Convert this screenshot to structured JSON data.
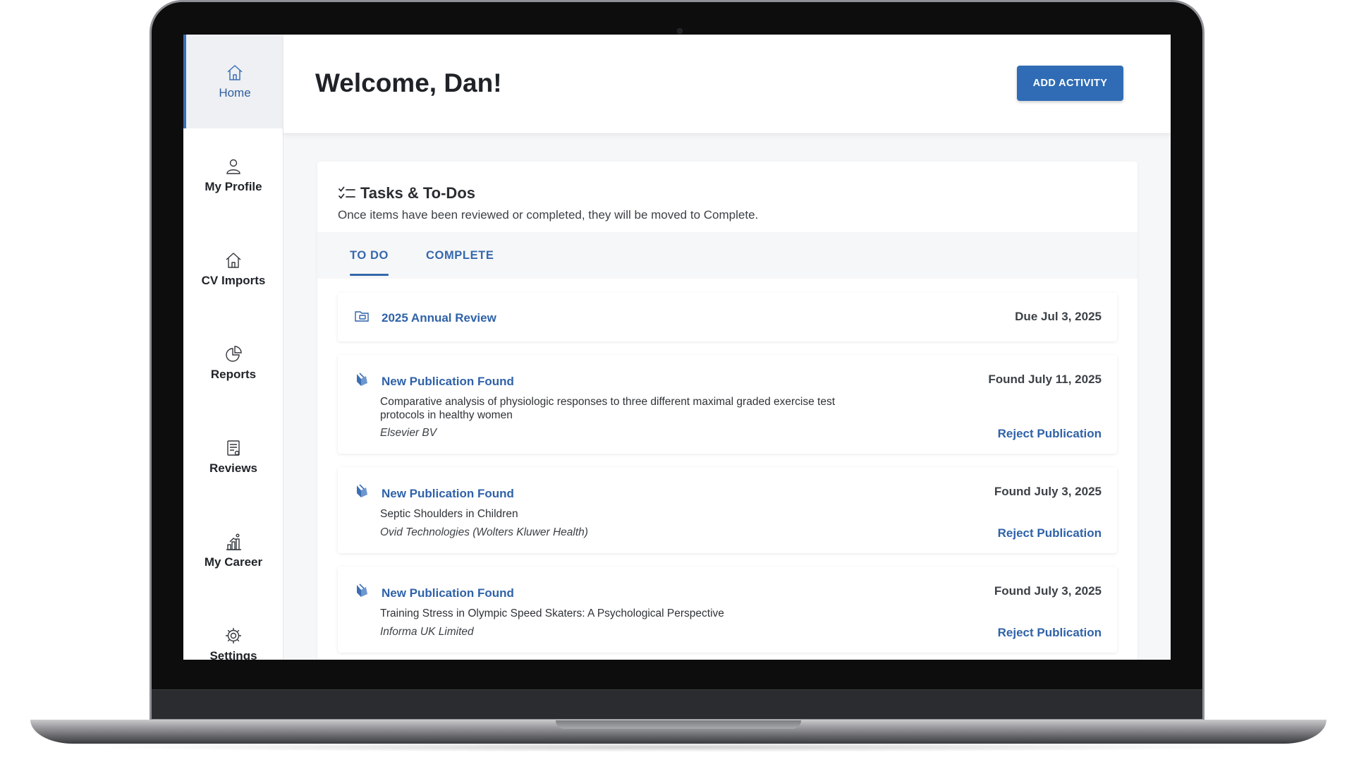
{
  "sidebar": {
    "items": [
      {
        "label": "Home",
        "icon": "home-icon",
        "active": true
      },
      {
        "label": "My Profile",
        "icon": "user-icon"
      },
      {
        "label": "CV Imports",
        "icon": "home-import-icon"
      },
      {
        "label": "Reports",
        "icon": "pie-chart-icon"
      },
      {
        "label": "Reviews",
        "icon": "document-icon"
      },
      {
        "label": "My Career",
        "icon": "career-ladder-icon"
      },
      {
        "label": "Settings",
        "icon": "gear-icon"
      }
    ]
  },
  "header": {
    "title": "Welcome, Dan!",
    "add_button_label": "ADD ACTIVITY"
  },
  "tasks": {
    "title": "Tasks & To-Dos",
    "subtitle": "Once items have been reviewed or completed, they will be moved to Complete.",
    "tabs": [
      {
        "label": "TO DO",
        "active": true
      },
      {
        "label": "COMPLETE",
        "active": false
      }
    ],
    "items": [
      {
        "type": "review",
        "icon": "folder-icon",
        "title": "2025 Annual Review",
        "date": "Due Jul 3, 2025"
      },
      {
        "type": "publication",
        "icon": "publication-icon",
        "title": "New Publication Found",
        "date": "Found July 11, 2025",
        "description": "Comparative analysis of physiologic responses to three different maximal graded exercise test protocols in healthy women",
        "source": "Elsevier BV",
        "action": "Reject Publication"
      },
      {
        "type": "publication",
        "icon": "publication-icon",
        "title": "New Publication Found",
        "date": "Found July 3, 2025",
        "description": "Septic Shoulders in Children",
        "source": "Ovid Technologies (Wolters Kluwer Health)",
        "action": "Reject Publication"
      },
      {
        "type": "publication",
        "icon": "publication-icon",
        "title": "New Publication Found",
        "date": "Found July 3, 2025",
        "description": "Training Stress in Olympic Speed Skaters: A Psychological Perspective",
        "source": "Informa UK Limited",
        "action": "Reject Publication"
      }
    ]
  },
  "colors": {
    "accent": "#2f6cb5",
    "link": "#2f62a8",
    "sidebar_active_bg": "#eef0f3"
  }
}
